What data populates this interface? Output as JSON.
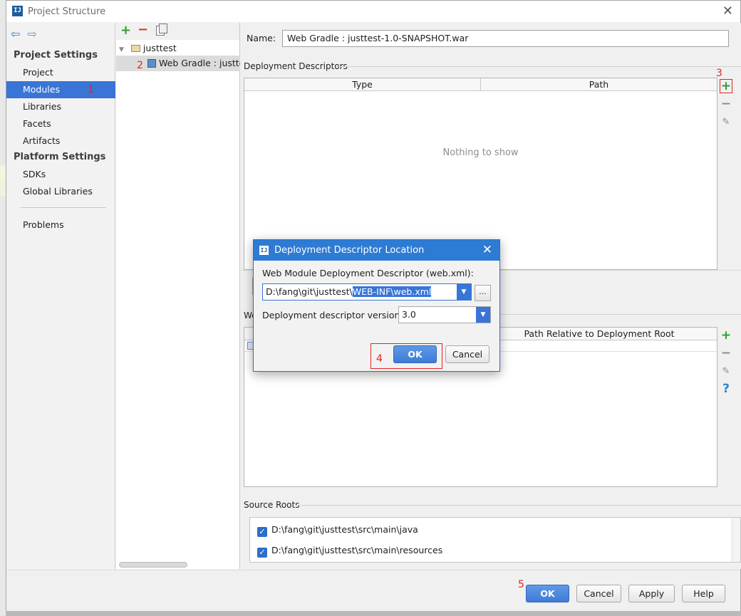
{
  "window": {
    "title": "Project Structure",
    "app_icon": "intellij-icon",
    "close_glyph": "✕"
  },
  "sidebar": {
    "back_glyph": "⇦",
    "forward_glyph": "⇨",
    "sections": [
      {
        "label": "Project Settings"
      },
      {
        "label": "Platform Settings"
      }
    ],
    "items": [
      {
        "label": "Project"
      },
      {
        "label": "Modules",
        "selected": true
      },
      {
        "label": "Libraries"
      },
      {
        "label": "Facets"
      },
      {
        "label": "Artifacts"
      },
      {
        "label": "SDKs"
      },
      {
        "label": "Global Libraries"
      },
      {
        "label": "Problems"
      }
    ]
  },
  "annotations": {
    "a1": "1",
    "a2": "2",
    "a3": "3",
    "a4": "4",
    "a5": "5",
    "color": "#e62222"
  },
  "tree": {
    "add_glyph": "+",
    "remove_glyph": "−",
    "root": {
      "label": "justtest"
    },
    "child": {
      "label": "Web Gradle : justte"
    }
  },
  "main": {
    "name_label": "Name:",
    "name_value": "Web Gradle : justtest-1.0-SNAPSHOT.war",
    "deployment_descriptors": {
      "label": "Deployment Descriptors",
      "columns": [
        "Type",
        "Path"
      ],
      "empty_text": "Nothing to show"
    },
    "web_resources": {
      "label_partial": "We",
      "columns": [
        "Path Relative to Deployment Root"
      ],
      "row_icon": "folder-icon"
    },
    "tools": {
      "add": "+",
      "remove": "−",
      "edit": "✎",
      "help": "?"
    },
    "source_roots": {
      "label": "Source Roots",
      "items": [
        {
          "path": "D:\\fang\\git\\justtest\\src\\main\\java",
          "checked": true
        },
        {
          "path": "D:\\fang\\git\\justtest\\src\\main\\resources",
          "checked": true
        }
      ]
    }
  },
  "footer": {
    "ok": "OK",
    "cancel": "Cancel",
    "apply": "Apply",
    "help": "Help"
  },
  "dialog": {
    "title": "Deployment Descriptor Location",
    "close_glyph": "✕",
    "descriptor_label": "Web Module Deployment Descriptor (web.xml):",
    "path_prefix": "D:\\fang\\git\\justtest\\",
    "path_selected": "WEB-INF\\web.xml",
    "browse_label": "...",
    "version_label": "Deployment descriptor version",
    "version_value": "3.0",
    "ok": "OK",
    "cancel": "Cancel"
  },
  "colors": {
    "selection": "#3875d7",
    "dialog_title": "#2e7bd4",
    "add_green": "#2aa12a",
    "remove_red": "#d23a2a"
  }
}
